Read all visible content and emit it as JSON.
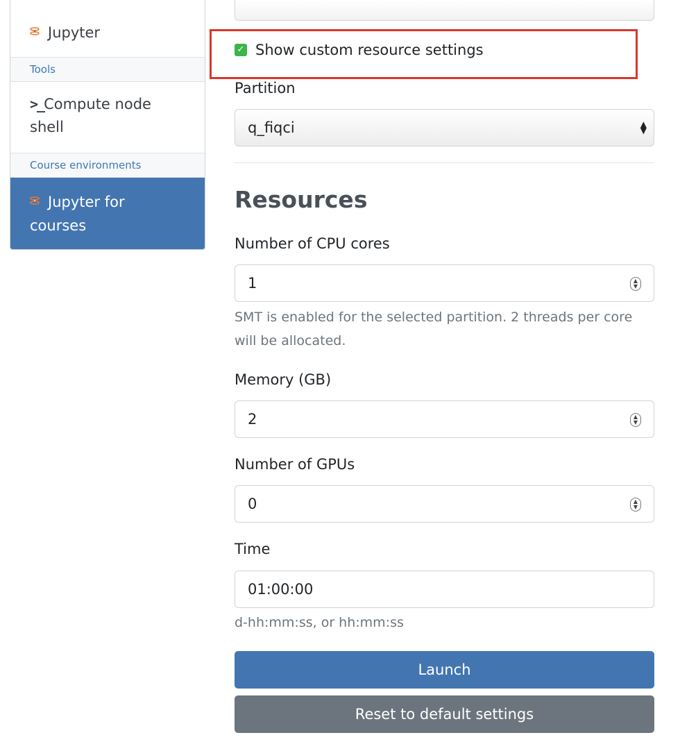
{
  "sidebar": {
    "jupyter_label": "Jupyter",
    "tools_header": "Tools",
    "shell_prompt": ">_",
    "shell_label_line1": "Compute node",
    "shell_label_line2": "shell",
    "course_header": "Course environments",
    "course_item_line1": "Jupyter for",
    "course_item_line2": "courses"
  },
  "form": {
    "custom_settings_label": "Show custom resource settings",
    "custom_settings_checked": true,
    "partition_label": "Partition",
    "partition_value": "q_fiqci",
    "resources_title": "Resources",
    "cpu_label": "Number of CPU cores",
    "cpu_value": "1",
    "cpu_help": "SMT is enabled for the selected partition. 2 threads per core will be allocated.",
    "memory_label": "Memory (GB)",
    "memory_value": "2",
    "gpu_label": "Number of GPUs",
    "gpu_value": "0",
    "time_label": "Time",
    "time_value": "01:00:00",
    "time_help": "d-hh:mm:ss, or hh:mm:ss",
    "launch_label": "Launch",
    "reset_label": "Reset to default settings"
  },
  "colors": {
    "accent": "#4376b1",
    "secondary": "#6c757d",
    "highlight": "#d9362b",
    "checkbox": "#3cb54a"
  },
  "icons": {
    "jupyter": "jupyter-logo-icon",
    "terminal": "terminal-prompt-icon",
    "select_arrows": "select-arrows-icon",
    "spinner": "number-spinner-icon",
    "checkmark": "checkmark-icon"
  }
}
